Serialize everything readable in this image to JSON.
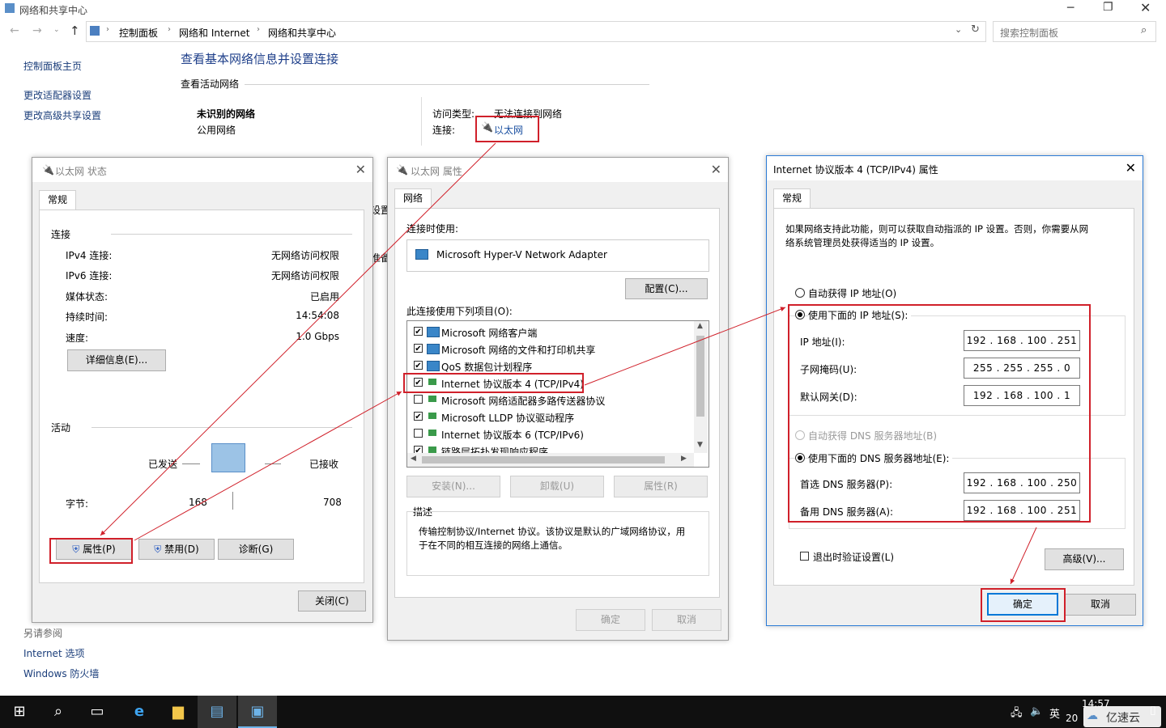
{
  "explorer": {
    "title": "网络和共享中心",
    "breadcrumb": [
      "控制面板",
      "网络和 Internet",
      "网络和共享中心"
    ],
    "search_placeholder": "搜索控制面板",
    "sidebar": {
      "home": "控制面板主页",
      "items": [
        "更改适配器设置",
        "更改高级共享设置"
      ],
      "see_also_title": "另请参阅",
      "see_also": [
        "Internet 选项",
        "Windows 防火墙"
      ]
    },
    "main": {
      "heading": "查看基本网络信息并设置连接",
      "active_networks": "查看活动网络",
      "network_name": "未识别的网络",
      "network_type": "公用网络",
      "access_type_label": "访问类型:",
      "access_type_value": "无法连接到网络",
      "connection_label": "连接:",
      "connection_value": "以太网",
      "partial1": "设置",
      "partial2": "准备"
    }
  },
  "status_dialog": {
    "title": "以太网 状态",
    "tab": "常规",
    "section_conn": "连接",
    "rows": [
      {
        "label": "IPv4 连接:",
        "value": "无网络访问权限"
      },
      {
        "label": "IPv6 连接:",
        "value": "无网络访问权限"
      },
      {
        "label": "媒体状态:",
        "value": "已启用"
      },
      {
        "label": "持续时间:",
        "value": "14:54:08"
      },
      {
        "label": "速度:",
        "value": "1.0 Gbps"
      }
    ],
    "details_btn": "详细信息(E)...",
    "section_activity": "活动",
    "sent_label": "已发送",
    "recv_label": "已接收",
    "bytes_label": "字节:",
    "bytes_sent": "168",
    "bytes_recv": "708",
    "properties_btn": "属性(P)",
    "disable_btn": "禁用(D)",
    "diagnose_btn": "诊断(G)",
    "close_btn": "关闭(C)"
  },
  "props_dialog": {
    "title": "以太网 属性",
    "tab": "网络",
    "connect_using": "连接时使用:",
    "adapter": "Microsoft Hyper-V Network Adapter",
    "configure_btn": "配置(C)...",
    "items_label": "此连接使用下列项目(O):",
    "items": [
      {
        "label": "Microsoft 网络客户端",
        "checked": "✔"
      },
      {
        "label": "Microsoft 网络的文件和打印机共享",
        "checked": "✔"
      },
      {
        "label": "QoS 数据包计划程序",
        "checked": "✔"
      },
      {
        "label": "Internet 协议版本 4 (TCP/IPv4)",
        "checked": "✔"
      },
      {
        "label": "Microsoft 网络适配器多路传送器协议",
        "checked": ""
      },
      {
        "label": "Microsoft LLDP 协议驱动程序",
        "checked": "✔"
      },
      {
        "label": "Internet 协议版本 6 (TCP/IPv6)",
        "checked": ""
      },
      {
        "label": "链路层拓扑发现响应程序",
        "checked": "✔"
      }
    ],
    "install_btn": "安装(N)...",
    "uninstall_btn": "卸载(U)",
    "properties_btn": "属性(R)",
    "desc_title": "描述",
    "desc_text1": "传输控制协议/Internet 协议。该协议是默认的广域网络协议，用",
    "desc_text2": "于在不同的相互连接的网络上通信。",
    "ok_btn": "确定",
    "cancel_btn": "取消"
  },
  "ipv4_dialog": {
    "title": "Internet 协议版本 4 (TCP/IPv4) 属性",
    "tab": "常规",
    "intro1": "如果网络支持此功能，则可以获取自动指派的 IP 设置。否则，你需要从网",
    "intro2": "络系统管理员处获得适当的 IP 设置。",
    "auto_ip": "自动获得 IP 地址(O)",
    "manual_ip": "使用下面的 IP 地址(S):",
    "ip_label": "IP 地址(I):",
    "ip_value": "192 . 168 . 100 . 251",
    "mask_label": "子网掩码(U):",
    "mask_value": "255 . 255 . 255 .  0",
    "gw_label": "默认网关(D):",
    "gw_value": "192 . 168 . 100 .  1",
    "auto_dns": "自动获得 DNS 服务器地址(B)",
    "manual_dns": "使用下面的 DNS 服务器地址(E):",
    "dns1_label": "首选 DNS 服务器(P):",
    "dns1_value": "192 . 168 . 100 . 250",
    "dns2_label": "备用 DNS 服务器(A):",
    "dns2_value": "192 . 168 . 100 . 251",
    "validate": "退出时验证设置(L)",
    "advanced_btn": "高级(V)...",
    "ok_btn": "确定",
    "cancel_btn": "取消"
  },
  "taskbar": {
    "time": "14:57",
    "date_partial": "20",
    "ime": "英",
    "watermark": "亿速云"
  },
  "colors": {
    "annotation": "#d0202a",
    "link": "#1a4fa0",
    "accent": "#0078d7"
  }
}
